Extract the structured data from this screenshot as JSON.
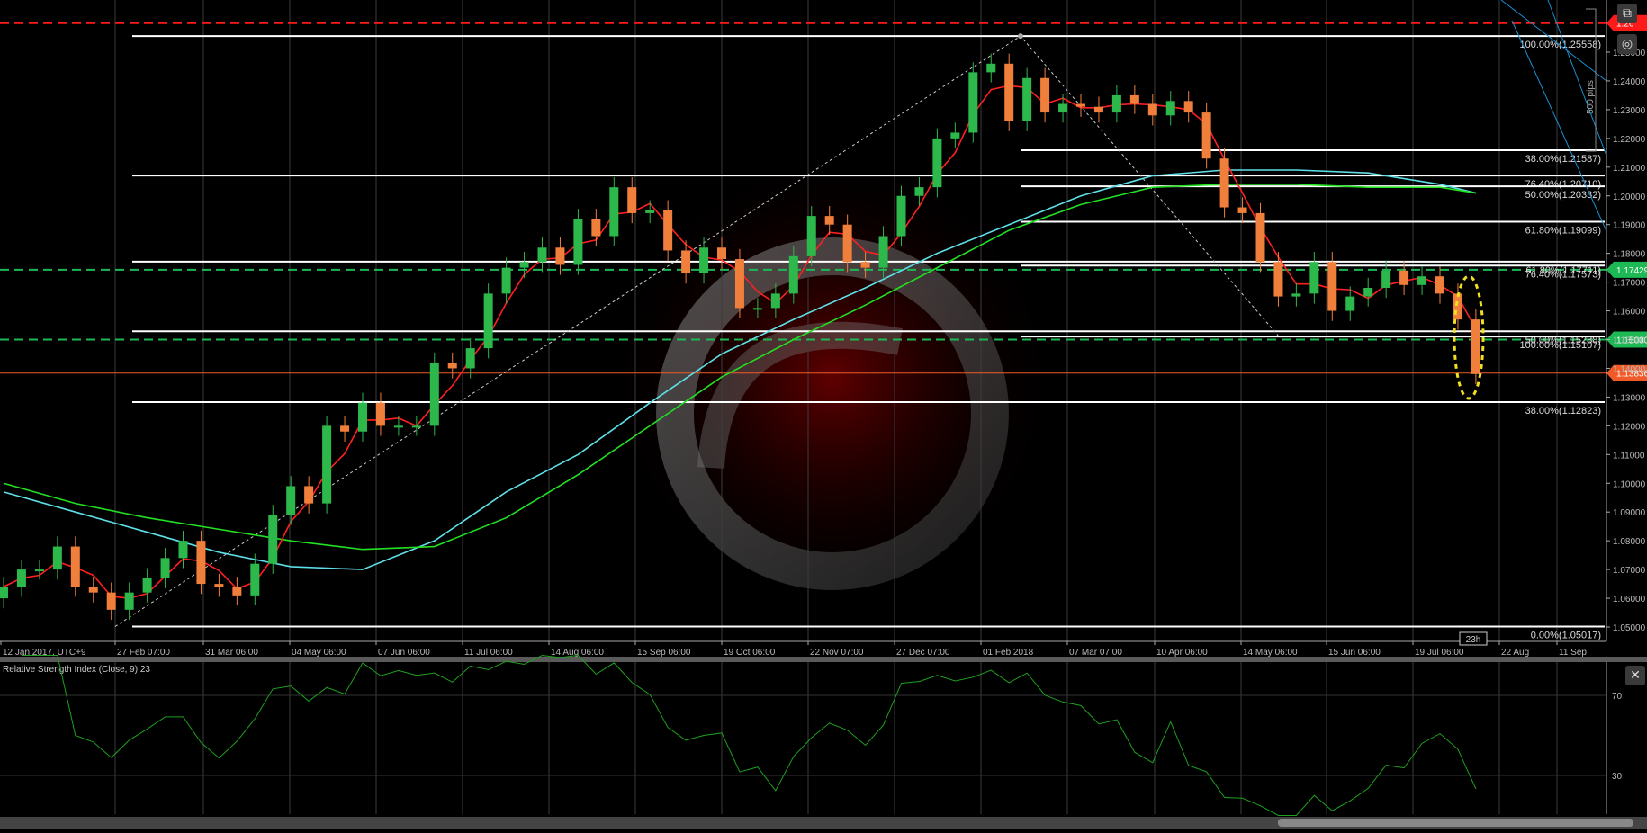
{
  "chart_data": {
    "type": "candlestick",
    "instrument_hint": "",
    "x_ticks": [
      "12 Jan 2017, UTC+9",
      "27 Feb 07:00",
      "31 Mar 06:00",
      "04 May 06:00",
      "07 Jun 06:00",
      "11 Jul 06:00",
      "14 Aug 06:00",
      "15 Sep 06:00",
      "19 Oct 06:00",
      "22 Nov 07:00",
      "27 Dec 07:00",
      "01 Feb 2018",
      "07 Mar 07:00",
      "10 Apr 06:00",
      "14 May 06:00",
      "15 Jun 06:00",
      "19 Jul 06:00",
      "22 Aug",
      "11 Sep"
    ],
    "y_ticks": [
      "1.25000",
      "1.24000",
      "1.23000",
      "1.22000",
      "1.21000",
      "1.20000",
      "1.19000",
      "1.18000",
      "1.17000",
      "1.16000",
      "1.15000",
      "1.14000",
      "1.13000",
      "1.12000",
      "1.11000",
      "1.10000",
      "1.09000",
      "1.08000",
      "1.07000",
      "1.06000",
      "1.05000"
    ],
    "ylim": [
      1.045,
      1.265
    ],
    "weekly_close": [
      1.064,
      1.07,
      1.07,
      1.078,
      1.064,
      1.062,
      1.056,
      1.062,
      1.067,
      1.074,
      1.08,
      1.065,
      1.064,
      1.061,
      1.072,
      1.089,
      1.099,
      1.093,
      1.12,
      1.118,
      1.128,
      1.12,
      1.12,
      1.12,
      1.142,
      1.14,
      1.147,
      1.166,
      1.175,
      1.177,
      1.182,
      1.176,
      1.192,
      1.186,
      1.203,
      1.194,
      1.195,
      1.181,
      1.173,
      1.182,
      1.178,
      1.161,
      1.161,
      1.166,
      1.179,
      1.193,
      1.19,
      1.177,
      1.175,
      1.186,
      1.2,
      1.203,
      1.22,
      1.222,
      1.243,
      1.246,
      1.226,
      1.241,
      1.229,
      1.232,
      1.231,
      1.229,
      1.235,
      1.232,
      1.228,
      1.233,
      1.229,
      1.213,
      1.196,
      1.194,
      1.177,
      1.165,
      1.166,
      1.177,
      1.16,
      1.165,
      1.168,
      1.174,
      1.169,
      1.172,
      1.166,
      1.157,
      1.138
    ],
    "colors": {
      "up": "#2db84b",
      "down": "#f07f3c",
      "ma_fast": "#ff2020",
      "ma_cyan": "#5ee0e8",
      "ma_green": "#22e022",
      "rsi": "#1fa01f"
    },
    "ma_cyan": {
      "week_index": [
        0,
        4,
        8,
        12,
        16,
        20,
        24,
        28,
        32,
        36,
        40,
        44,
        48,
        52,
        56,
        60,
        64,
        68,
        72,
        76,
        80,
        82
      ],
      "values": [
        1.097,
        1.09,
        1.083,
        1.076,
        1.071,
        1.07,
        1.08,
        1.097,
        1.11,
        1.128,
        1.145,
        1.157,
        1.168,
        1.18,
        1.19,
        1.2,
        1.207,
        1.209,
        1.209,
        1.208,
        1.204,
        1.201
      ]
    },
    "ma_green": {
      "week_index": [
        0,
        4,
        8,
        12,
        16,
        20,
        24,
        28,
        32,
        36,
        40,
        44,
        48,
        52,
        56,
        60,
        64,
        68,
        72,
        76,
        80,
        82
      ],
      "values": [
        1.1,
        1.093,
        1.088,
        1.084,
        1.08,
        1.077,
        1.078,
        1.088,
        1.103,
        1.12,
        1.137,
        1.15,
        1.162,
        1.175,
        1.188,
        1.197,
        1.203,
        1.204,
        1.204,
        1.203,
        1.203,
        1.201
      ]
    },
    "horizontal_lines": [
      {
        "price": 1.2601,
        "style": "dashed",
        "color": "#ff1a1a",
        "label": "1.26"
      },
      {
        "price": 1.17429,
        "style": "dashed",
        "color": "#1db954",
        "label": "1.17429"
      },
      {
        "price": 1.15,
        "style": "dashed",
        "color": "#1db954",
        "label": "1.15000"
      },
      {
        "price": 1.13836,
        "style": "solid",
        "color": "#f05a28",
        "label": "1.13836"
      }
    ],
    "fib_left": [
      {
        "price": 1.25558,
        "label": "100.00%(1.25558)"
      },
      {
        "price": 1.2071,
        "label": "76.40%(1.20710)"
      },
      {
        "price": 1.17711,
        "label": "61.80%(1.17711)"
      },
      {
        "price": 1.15288,
        "label": "50.00%(1.15288)"
      },
      {
        "price": 1.12823,
        "label": "38.00%(1.12823)"
      },
      {
        "price": 1.05017,
        "label": "0.00%(1.05017)"
      }
    ],
    "fib_right": [
      {
        "price": 1.21587,
        "label": "38.00%(1.21587)"
      },
      {
        "price": 1.20332,
        "label": "50.00%(1.20332)"
      },
      {
        "price": 1.19099,
        "label": "61.80%(1.19099)"
      },
      {
        "price": 1.17573,
        "label": "76.40%(1.17573)"
      },
      {
        "price": 1.15107,
        "label": "100.00%(1.15107)"
      }
    ],
    "pips_label": "500 pips",
    "countdown": "23h",
    "rsi": {
      "title": "Relative Strength Index (Close, 9) 23",
      "levels": [
        "70",
        "30"
      ],
      "period": 9
    }
  }
}
